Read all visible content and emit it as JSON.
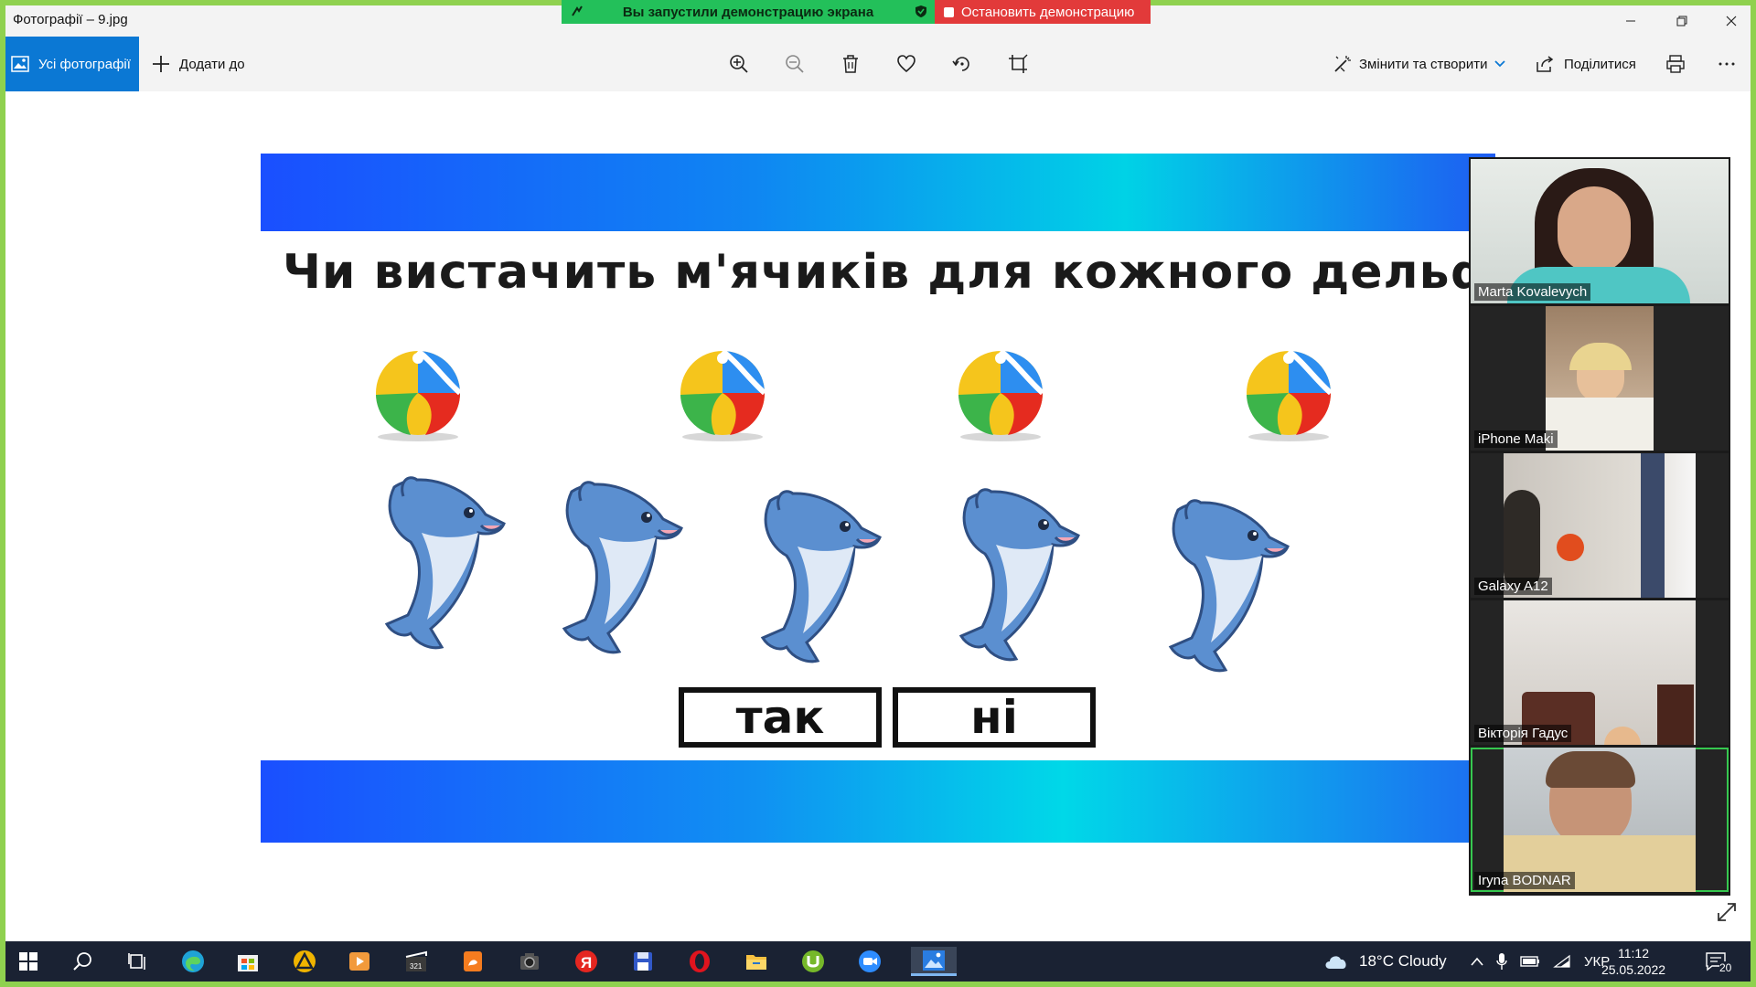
{
  "window": {
    "title": "Фотографії – 9.jpg"
  },
  "share_banner": {
    "status": "Вы запустили демонстрацию экрана",
    "stop_label": "Остановить демонстрацию",
    "status_color": "#23c05a",
    "stop_color": "#e23a3a"
  },
  "toolbar": {
    "all_photos": "Усі фотографії",
    "add_to": "Додати до",
    "edit_create": "Змінити та створити",
    "share": "Поділитися",
    "accent": "#0b78d4"
  },
  "slide": {
    "question": "Чи вистачить м'ячиків для кожного дельфіна?",
    "balls_count": 4,
    "dolphins_count": 5,
    "answer_yes": "так",
    "answer_no": "ні"
  },
  "participants": [
    {
      "name": "Marta Kovalevych"
    },
    {
      "name": "iPhone Maki"
    },
    {
      "name": "Galaxy A12"
    },
    {
      "name": "Вікторія Гадус"
    },
    {
      "name": "Iryna BODNAR"
    }
  ],
  "taskbar": {
    "weather": "18°C  Cloudy",
    "language": "УКР",
    "time": "11:12",
    "date": "25.05.2022",
    "notifications": "20"
  },
  "icons": [
    "windows-start-icon",
    "search-icon",
    "task-view-icon",
    "edge-icon",
    "store-icon",
    "app-icon",
    "media-player-icon",
    "video-editor-icon",
    "pdf-icon",
    "camera-icon",
    "yandex-icon",
    "save-icon",
    "opera-icon",
    "file-explorer-icon",
    "utorrent-icon",
    "zoom-icon",
    "photos-icon"
  ]
}
